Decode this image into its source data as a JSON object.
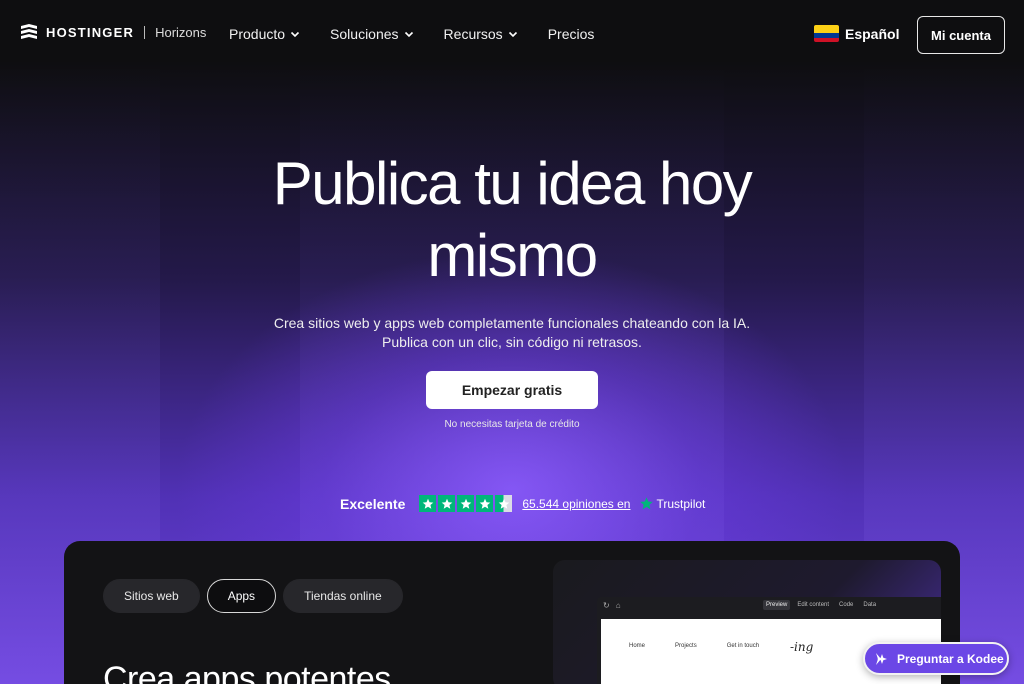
{
  "header": {
    "brand": "HOSTINGER",
    "brand_sub": "Horizons",
    "menu": [
      {
        "label": "Producto",
        "has_dropdown": true
      },
      {
        "label": "Soluciones",
        "has_dropdown": true
      },
      {
        "label": "Recursos",
        "has_dropdown": true
      },
      {
        "label": "Precios",
        "has_dropdown": false
      }
    ],
    "language": "Español",
    "account_label": "Mi cuenta"
  },
  "hero": {
    "title_line1": "Publica tu idea hoy",
    "title_line2": "mismo",
    "subtitle_line1": "Crea sitios web y apps web completamente funcionales chateando con la IA.",
    "subtitle_line2": "Publica con un clic, sin código ni retrasos.",
    "cta_label": "Empezar gratis",
    "cta_note": "No necesitas tarjeta de crédito"
  },
  "trust": {
    "rating_word": "Excelente",
    "stars": 4.5,
    "reviews_link": "65.544 opiniones en",
    "provider": "Trustpilot"
  },
  "showcase": {
    "tabs": [
      {
        "label": "Sitios web",
        "active": false
      },
      {
        "label": "Apps",
        "active": true
      },
      {
        "label": "Tiendas online",
        "active": false
      }
    ],
    "heading": "Crea apps potentes",
    "preview": {
      "toolbar_tabs": [
        {
          "label": "Preview",
          "active": true
        },
        {
          "label": "Edit content",
          "active": false
        },
        {
          "label": "Code",
          "active": false
        },
        {
          "label": "Data",
          "active": false
        }
      ],
      "site_nav": [
        "Home",
        "Projects",
        "Get in touch"
      ],
      "site_logo": "-ing"
    }
  },
  "assistant": {
    "label": "Preguntar a Kodee"
  },
  "colors": {
    "accent": "#6b47e6",
    "trustpilot_green": "#00b67a",
    "background": "#0e0e10"
  }
}
